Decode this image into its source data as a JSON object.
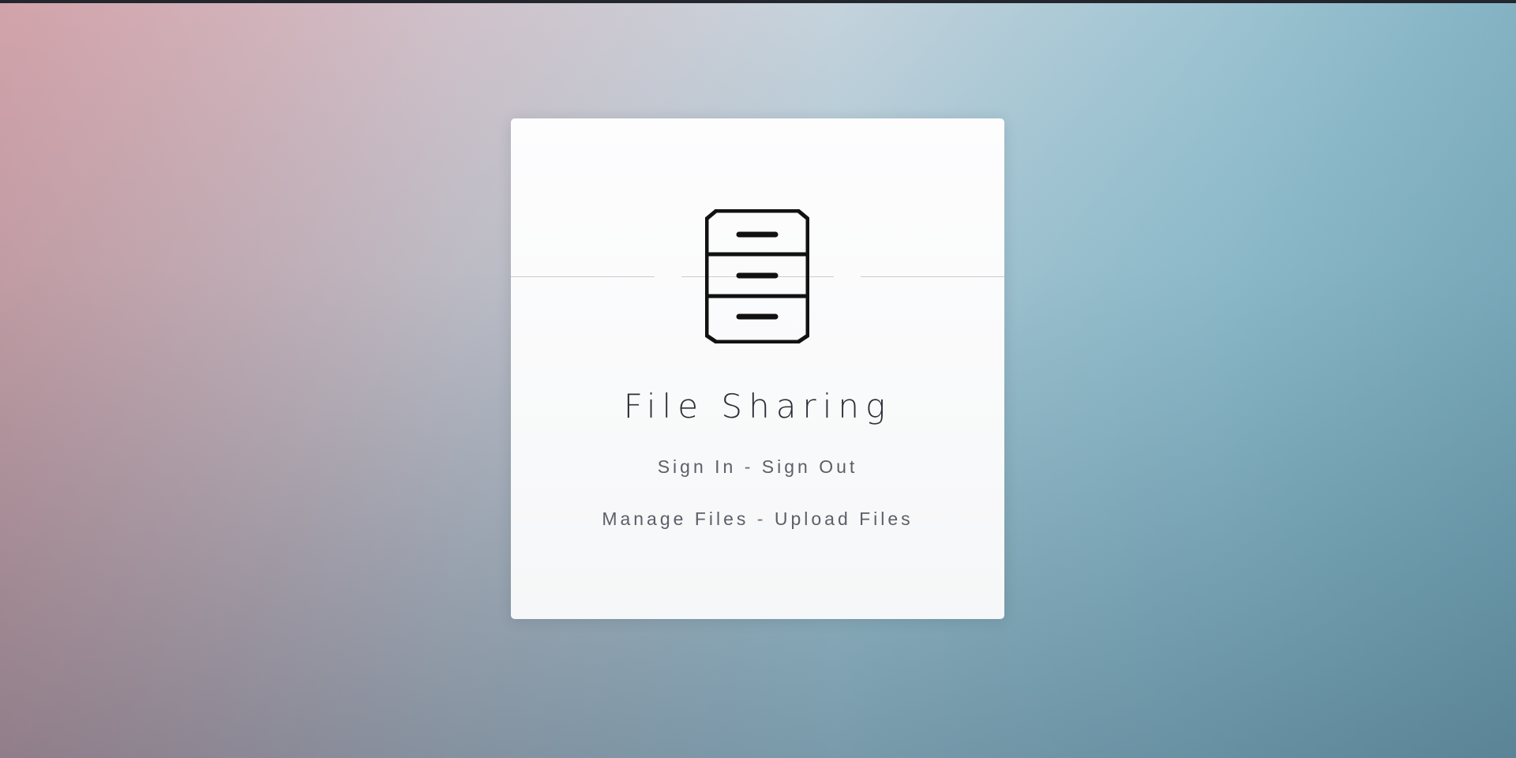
{
  "app": {
    "title": "File Sharing",
    "icon": "file-cabinet-icon"
  },
  "links_row_1": {
    "sign_in": "Sign In",
    "separator": " - ",
    "sign_out": "Sign Out"
  },
  "links_row_2": {
    "manage_files": "Manage Files",
    "separator": " - ",
    "upload_files": "Upload Files"
  },
  "colors": {
    "background_top_left": "#debec8",
    "background_top_right": "#8fdcec",
    "background_bottom_left": "#b7868f",
    "background_bottom_right": "#5b8293",
    "card": "#fbfbfc",
    "title_text": "#2c2f36",
    "link_text": "#5b5f68",
    "icon": "#111111"
  }
}
